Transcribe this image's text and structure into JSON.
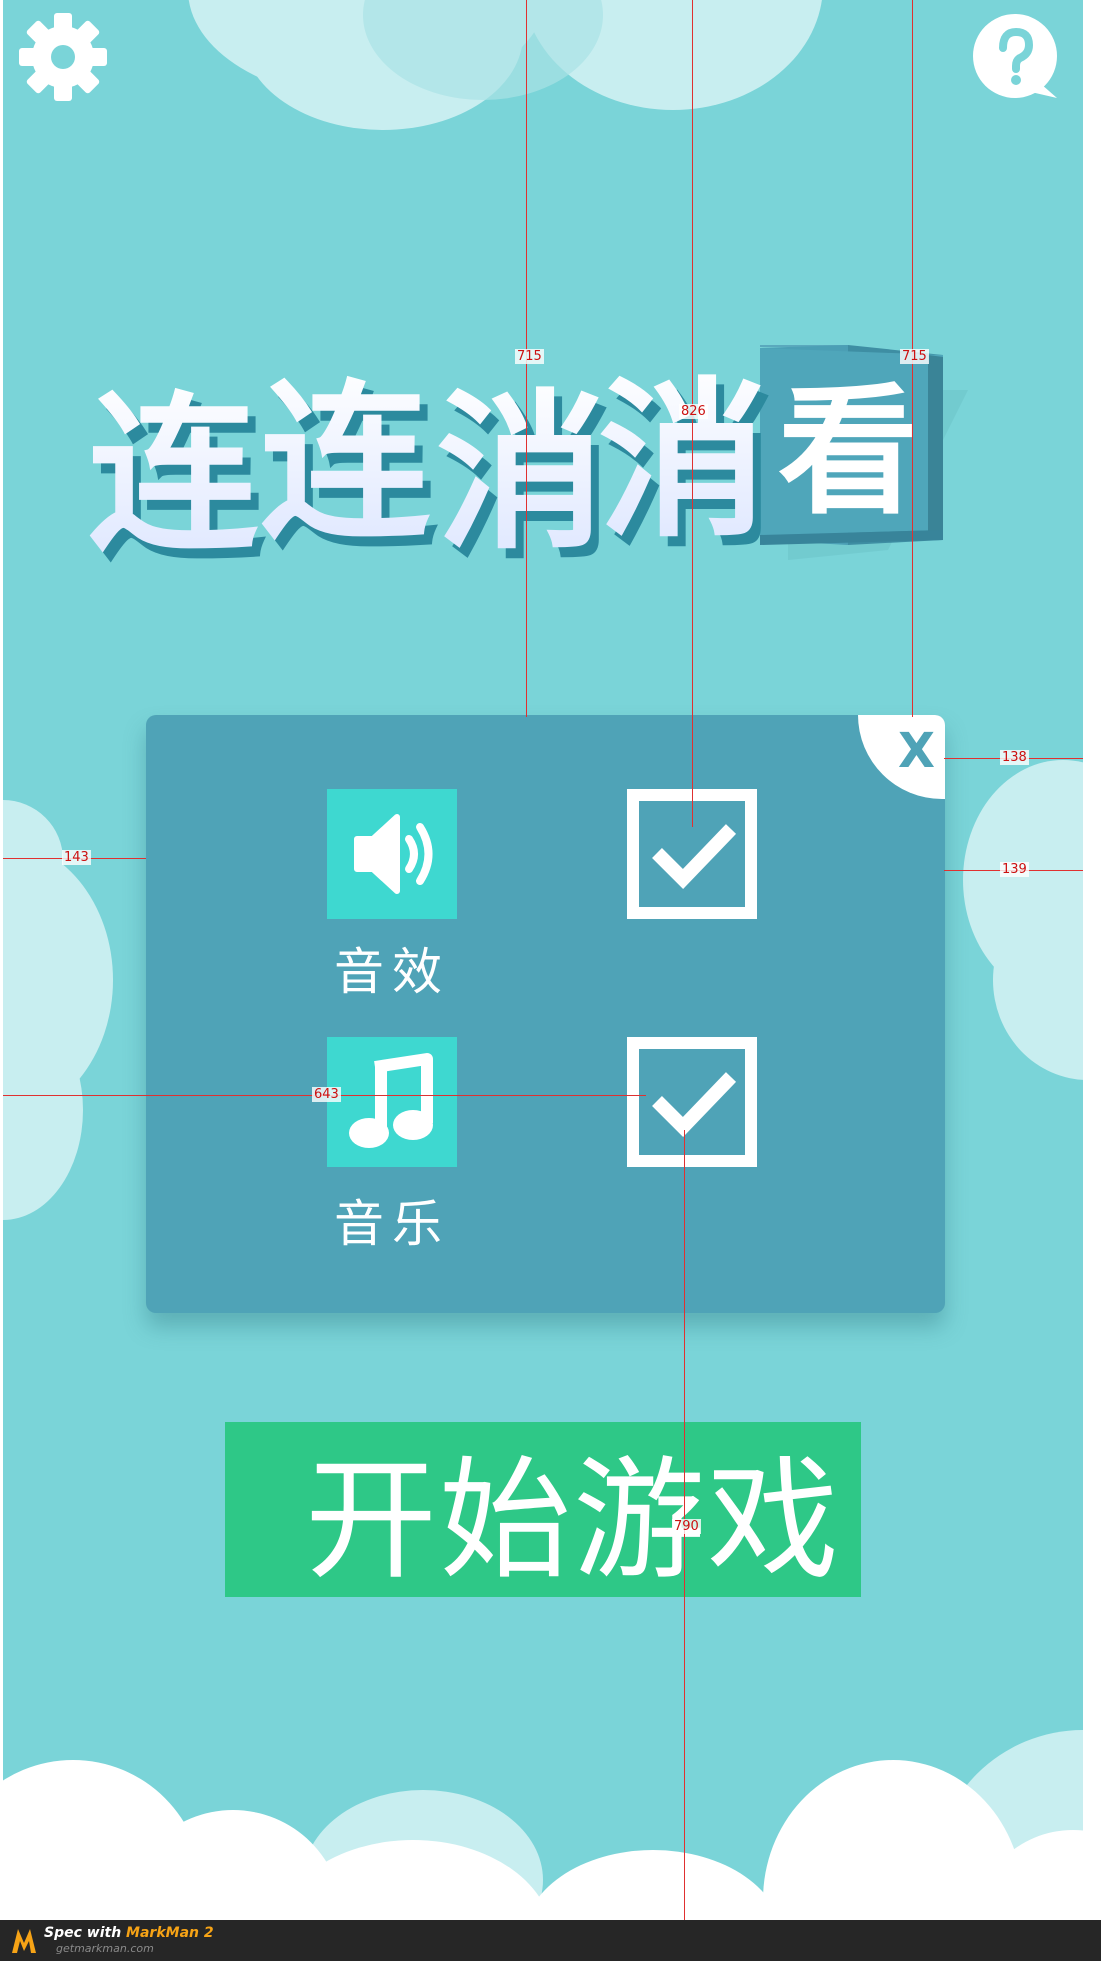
{
  "app": {
    "title_chars": [
      "连",
      "连",
      "消",
      "消"
    ],
    "title_badge_char": "看"
  },
  "toolbar": {
    "settings_icon": "gear-icon",
    "help_icon": "help-bubble-icon"
  },
  "settings_panel": {
    "close_label": "X",
    "options": [
      {
        "label": "音效",
        "icon": "speaker-icon",
        "checked": true
      },
      {
        "label": "音乐",
        "icon": "music-note-icon",
        "checked": true
      }
    ]
  },
  "start_button": {
    "label": "开始游戏"
  },
  "spec_annotations": [
    "715",
    "826",
    "715",
    "138",
    "143",
    "139",
    "643",
    "790"
  ],
  "footer": {
    "prefix": "Spec with",
    "brand": "MarkMan 2",
    "url": "getmarkman.com"
  },
  "colors": {
    "background": "#7ad4d8",
    "panel": "#4fa3b7",
    "icon_tile": "#3ed8d0",
    "start_button": "#2ec887",
    "spec_line": "#e03030"
  }
}
